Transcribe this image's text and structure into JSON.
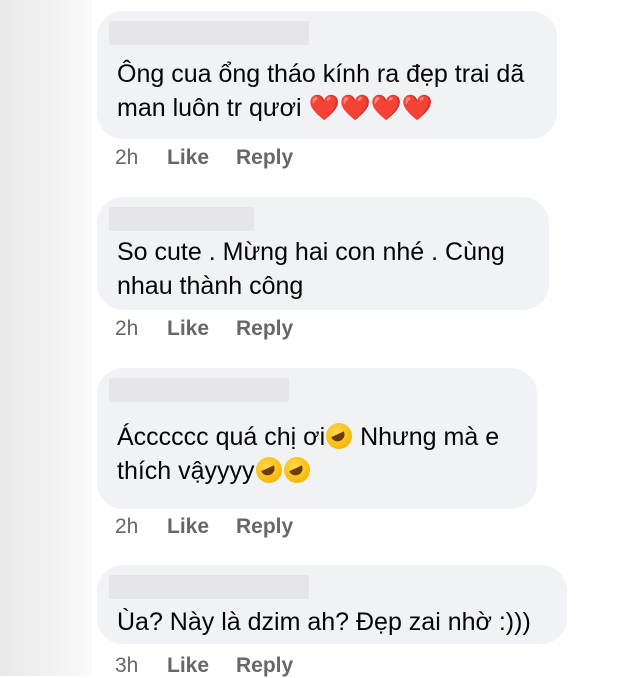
{
  "comments": [
    {
      "text": "Ông cua ổng tháo kính ra đẹp trai dã\nman luôn tr qươi ",
      "emoji": "❤️❤️❤️❤️",
      "time": "2h",
      "like": "Like",
      "reply": "Reply"
    },
    {
      "text": "So cute . Mừng hai con nhé . Cùng\nnhau thành công",
      "time": "2h",
      "like": "Like",
      "reply": "Reply"
    },
    {
      "text": "Ácccccc quá chị ơi",
      "text2": " Nhưng mà e\nthích vậyyyy",
      "time": "2h",
      "like": "Like",
      "reply": "Reply"
    },
    {
      "text": "Ùa? Này là dzim ah? Đẹp zai nhờ :)))",
      "time": "3h",
      "like": "Like",
      "reply": "Reply"
    }
  ],
  "colors": {
    "bubble": "#f0f2f5",
    "meta": "#65676b",
    "heart": "#e0281e"
  }
}
